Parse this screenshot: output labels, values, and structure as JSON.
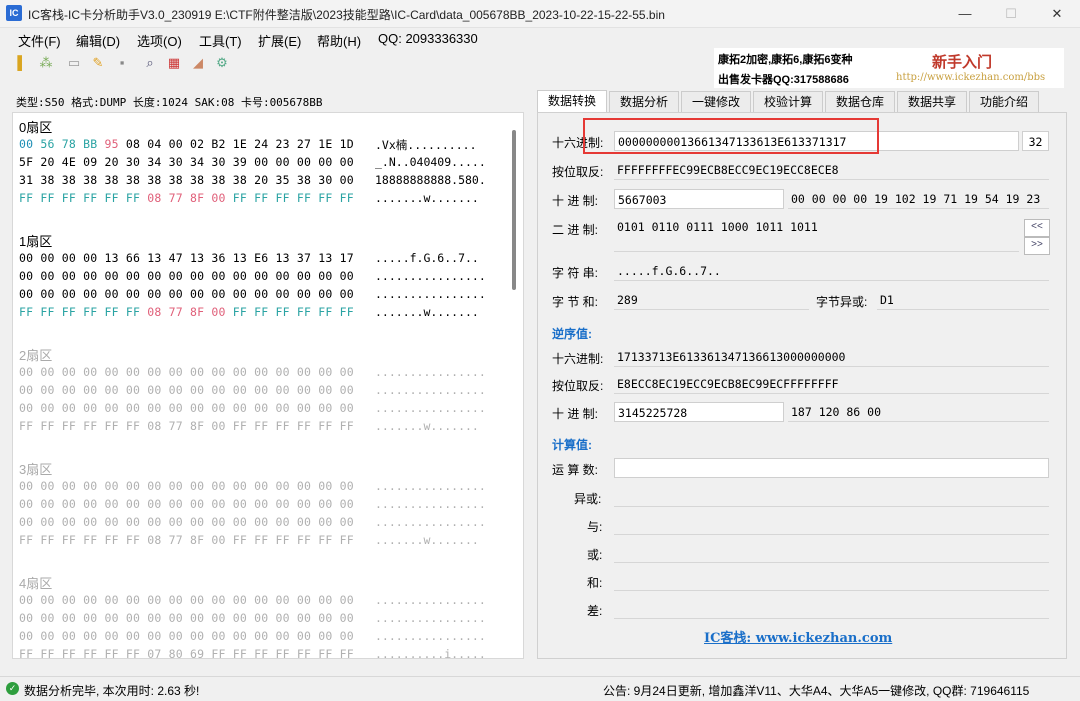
{
  "window": {
    "title": "IC客栈-IC卡分析助手V3.0_230919     E:\\CTF附件整洁版\\2023技能型路\\IC-Card\\data_005678BB_2023-10-22-15-22-55.bin",
    "minimize": "—",
    "maximize": "☐",
    "close": "✕"
  },
  "menu": {
    "file": "文件(F)",
    "edit": "编辑(D)",
    "options": "选项(O)",
    "tools": "工具(T)",
    "extend": "扩展(E)",
    "help": "帮助(H)",
    "qq": "QQ: 2093336330"
  },
  "ad": {
    "line1": "康拓2加密,康拓6,康拓6变种",
    "line2": "出售发卡器QQ:317588686",
    "brand": "新手入门",
    "url": "http://www.ickezhan.com/bbs"
  },
  "card_info": "类型:S50 格式:DUMP 长度:1024 SAK:08 卡号:005678BB",
  "sectors": [
    {
      "title": "0扇区",
      "rows": [
        {
          "hex": [
            "00",
            "56",
            "78",
            "BB",
            "95",
            "08",
            "04",
            "00",
            "02",
            "B2",
            "1E",
            "24",
            "23",
            "27",
            "1E",
            "1D"
          ],
          "ascii": ".Vx楠.........."
        },
        {
          "hex": [
            "5F",
            "20",
            "4E",
            "09",
            "20",
            "30",
            "34",
            "30",
            "34",
            "30",
            "39",
            "00",
            "00",
            "00",
            "00",
            "00"
          ],
          "ascii": "_.N..040409....."
        },
        {
          "hex": [
            "31",
            "38",
            "38",
            "38",
            "38",
            "38",
            "38",
            "38",
            "38",
            "38",
            "38",
            "20",
            "35",
            "38",
            "30",
            "00"
          ],
          "ascii": "18888888888.580."
        },
        {
          "hex": [
            "FF",
            "FF",
            "FF",
            "FF",
            "FF",
            "FF",
            "08",
            "77",
            "8F",
            "00",
            "FF",
            "FF",
            "FF",
            "FF",
            "FF",
            "FF"
          ],
          "ascii": ".......w......."
        }
      ]
    },
    {
      "title": "1扇区",
      "rows": [
        {
          "hex": [
            "00",
            "00",
            "00",
            "00",
            "13",
            "66",
            "13",
            "47",
            "13",
            "36",
            "13",
            "E6",
            "13",
            "37",
            "13",
            "17"
          ],
          "ascii": ".....f.G.6..7.."
        },
        {
          "hex": [
            "00",
            "00",
            "00",
            "00",
            "00",
            "00",
            "00",
            "00",
            "00",
            "00",
            "00",
            "00",
            "00",
            "00",
            "00",
            "00"
          ],
          "ascii": "................"
        },
        {
          "hex": [
            "00",
            "00",
            "00",
            "00",
            "00",
            "00",
            "00",
            "00",
            "00",
            "00",
            "00",
            "00",
            "00",
            "00",
            "00",
            "00"
          ],
          "ascii": "................"
        },
        {
          "hex": [
            "FF",
            "FF",
            "FF",
            "FF",
            "FF",
            "FF",
            "08",
            "77",
            "8F",
            "00",
            "FF",
            "FF",
            "FF",
            "FF",
            "FF",
            "FF"
          ],
          "ascii": ".......w......."
        }
      ]
    },
    {
      "title": "2扇区",
      "rows": [
        {
          "hex": [
            "00",
            "00",
            "00",
            "00",
            "00",
            "00",
            "00",
            "00",
            "00",
            "00",
            "00",
            "00",
            "00",
            "00",
            "00",
            "00"
          ],
          "ascii": "................"
        },
        {
          "hex": [
            "00",
            "00",
            "00",
            "00",
            "00",
            "00",
            "00",
            "00",
            "00",
            "00",
            "00",
            "00",
            "00",
            "00",
            "00",
            "00"
          ],
          "ascii": "................"
        },
        {
          "hex": [
            "00",
            "00",
            "00",
            "00",
            "00",
            "00",
            "00",
            "00",
            "00",
            "00",
            "00",
            "00",
            "00",
            "00",
            "00",
            "00"
          ],
          "ascii": "................"
        },
        {
          "hex": [
            "FF",
            "FF",
            "FF",
            "FF",
            "FF",
            "FF",
            "08",
            "77",
            "8F",
            "00",
            "FF",
            "FF",
            "FF",
            "FF",
            "FF",
            "FF"
          ],
          "ascii": ".......w......."
        }
      ]
    },
    {
      "title": "3扇区",
      "rows": [
        {
          "hex": [
            "00",
            "00",
            "00",
            "00",
            "00",
            "00",
            "00",
            "00",
            "00",
            "00",
            "00",
            "00",
            "00",
            "00",
            "00",
            "00"
          ],
          "ascii": "................"
        },
        {
          "hex": [
            "00",
            "00",
            "00",
            "00",
            "00",
            "00",
            "00",
            "00",
            "00",
            "00",
            "00",
            "00",
            "00",
            "00",
            "00",
            "00"
          ],
          "ascii": "................"
        },
        {
          "hex": [
            "00",
            "00",
            "00",
            "00",
            "00",
            "00",
            "00",
            "00",
            "00",
            "00",
            "00",
            "00",
            "00",
            "00",
            "00",
            "00"
          ],
          "ascii": "................"
        },
        {
          "hex": [
            "FF",
            "FF",
            "FF",
            "FF",
            "FF",
            "FF",
            "08",
            "77",
            "8F",
            "00",
            "FF",
            "FF",
            "FF",
            "FF",
            "FF",
            "FF"
          ],
          "ascii": ".......w......."
        }
      ]
    },
    {
      "title": "4扇区",
      "rows": [
        {
          "hex": [
            "00",
            "00",
            "00",
            "00",
            "00",
            "00",
            "00",
            "00",
            "00",
            "00",
            "00",
            "00",
            "00",
            "00",
            "00",
            "00"
          ],
          "ascii": "................"
        },
        {
          "hex": [
            "00",
            "00",
            "00",
            "00",
            "00",
            "00",
            "00",
            "00",
            "00",
            "00",
            "00",
            "00",
            "00",
            "00",
            "00",
            "00"
          ],
          "ascii": "................"
        },
        {
          "hex": [
            "00",
            "00",
            "00",
            "00",
            "00",
            "00",
            "00",
            "00",
            "00",
            "00",
            "00",
            "00",
            "00",
            "00",
            "00",
            "00"
          ],
          "ascii": "................"
        },
        {
          "hex": [
            "FF",
            "FF",
            "FF",
            "FF",
            "FF",
            "FF",
            "07",
            "80",
            "69",
            "FF",
            "FF",
            "FF",
            "FF",
            "FF",
            "FF",
            "FF"
          ],
          "ascii": "..........i....."
        }
      ]
    }
  ],
  "tabs": [
    "数据转换",
    "数据分析",
    "一键修改",
    "校验计算",
    "数据仓库",
    "数据共享",
    "功能介绍"
  ],
  "convert": {
    "hex_label": "十六进制:",
    "hex_value": "00000000013661347133613E613371317",
    "hex_len": "32",
    "invert_label": "按位取反:",
    "invert_value": "FFFFFFFFEC99ECB8ECC9EC19ECC8ECE8",
    "dec_label": "十 进 制:",
    "dec_value": "5667003",
    "dec_bytes": "00 00 00 00 19 102 19 71 19 54 19 23",
    "bin_label": "二 进 制:",
    "bin_value": "0101 0110 0111 1000 1011 1011",
    "str_label": "字 符 串:",
    "str_value": ".....f.G.6..7..",
    "sum_label": "字 节 和:",
    "sum_value": "289",
    "xor_label": "字节异或:",
    "xor_value": "D1",
    "rev_heading": "逆序值:",
    "rev_hex_label": "十六进制:",
    "rev_hex_value": "17133713E613361347136613000000000",
    "rev_invert_label": "按位取反:",
    "rev_invert_value": "E8ECC8EC19ECC9ECB8EC99ECFFFFFFFF",
    "rev_dec_label": "十 进 制:",
    "rev_dec_value": "3145225728",
    "rev_dec_bytes": "187 120 86 00",
    "calc_heading": "计算值:",
    "op_label": "运 算 数:",
    "xor_op_label": "异或:",
    "and_label": "与:",
    "or_label": "或:",
    "add_label": "和:",
    "sub_label": "差:",
    "btn_left": "<<",
    "btn_right": ">>",
    "footer_link": "IC客栈: www.ickezhan.com"
  },
  "status": {
    "message": "数据分析完毕, 本次用时: 2.63 秒!",
    "notice": "公告: 9月24日更新, 增加鑫洋V11、大华A4、大华A5一键修改, QQ群: 719646115"
  }
}
